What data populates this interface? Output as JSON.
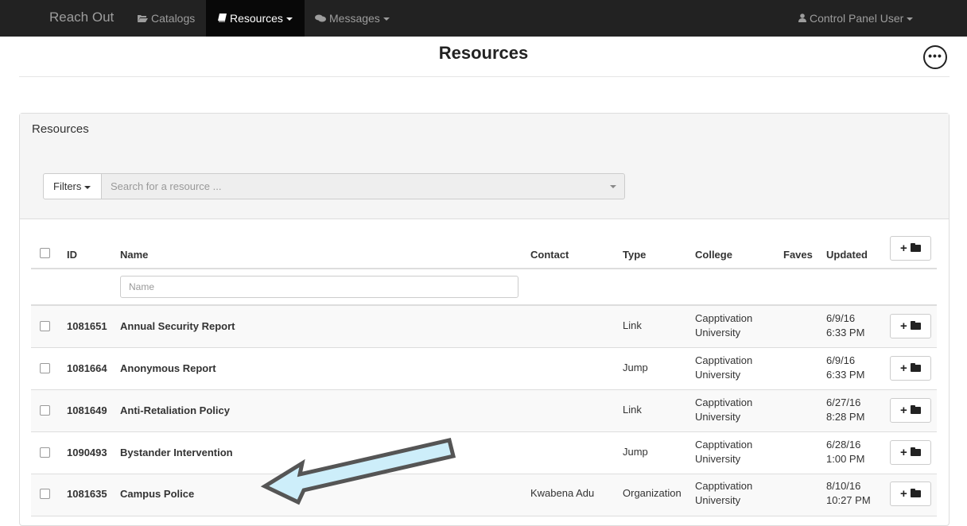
{
  "navbar": {
    "brand": "Reach Out",
    "items": [
      {
        "label": "Catalogs",
        "icon": "folder-open-icon"
      },
      {
        "label": "Resources",
        "icon": "book-icon",
        "active": true
      },
      {
        "label": "Messages",
        "icon": "comments-icon"
      }
    ],
    "user": "Control Panel User",
    "user_icon": "user-icon"
  },
  "page": {
    "title": "Resources",
    "more_label": "•••"
  },
  "panel": {
    "title": "Resources",
    "filters_label": "Filters",
    "search_placeholder": "Search for a resource ..."
  },
  "table": {
    "headers": {
      "id": "ID",
      "name": "Name",
      "contact": "Contact",
      "type": "Type",
      "college": "College",
      "faves": "Faves",
      "updated": "Updated"
    },
    "name_filter_placeholder": "Name",
    "rows": [
      {
        "id": "1081651",
        "name": "Annual Security Report",
        "contact": "",
        "type": "Link",
        "college_1": "Capptivation",
        "college_2": "University",
        "date": "6/9/16",
        "time": "6:33 PM"
      },
      {
        "id": "1081664",
        "name": "Anonymous Report",
        "contact": "",
        "type": "Jump",
        "college_1": "Capptivation",
        "college_2": "University",
        "date": "6/9/16",
        "time": "6:33 PM"
      },
      {
        "id": "1081649",
        "name": "Anti-Retaliation Policy",
        "contact": "",
        "type": "Link",
        "college_1": "Capptivation",
        "college_2": "University",
        "date": "6/27/16",
        "time": "8:28 PM"
      },
      {
        "id": "1090493",
        "name": "Bystander Intervention",
        "contact": "",
        "type": "Jump",
        "college_1": "Capptivation",
        "college_2": "University",
        "date": "6/28/16",
        "time": "1:00 PM"
      },
      {
        "id": "1081635",
        "name": "Campus Police",
        "contact": "Kwabena Adu",
        "type": "Organization",
        "college_1": "Capptivation",
        "college_2": "University",
        "date": "8/10/16",
        "time": "10:27 PM"
      }
    ]
  },
  "colors": {
    "navbar_bg": "#222222",
    "arrow_fill": "#cdeefa",
    "arrow_stroke": "#555555"
  }
}
